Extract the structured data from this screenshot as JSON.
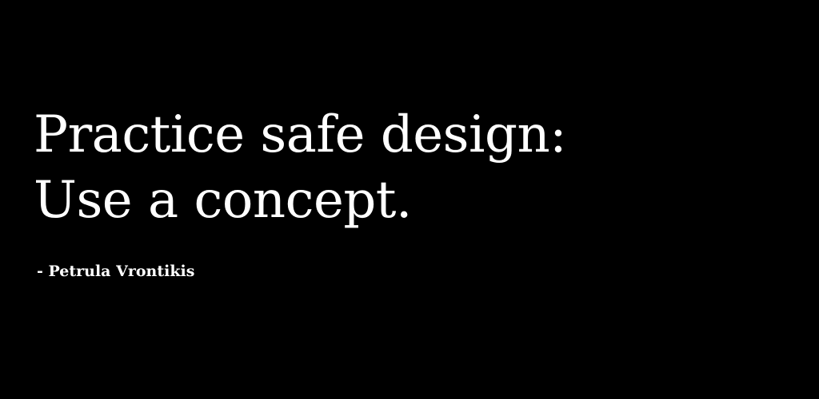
{
  "quote": {
    "line_1": "Practice safe design:",
    "line_2": "Use a concept."
  },
  "attribution": {
    "text": "- Petrula Vrontikis"
  },
  "colors": {
    "background": "#000000",
    "text": "#ffffff"
  }
}
